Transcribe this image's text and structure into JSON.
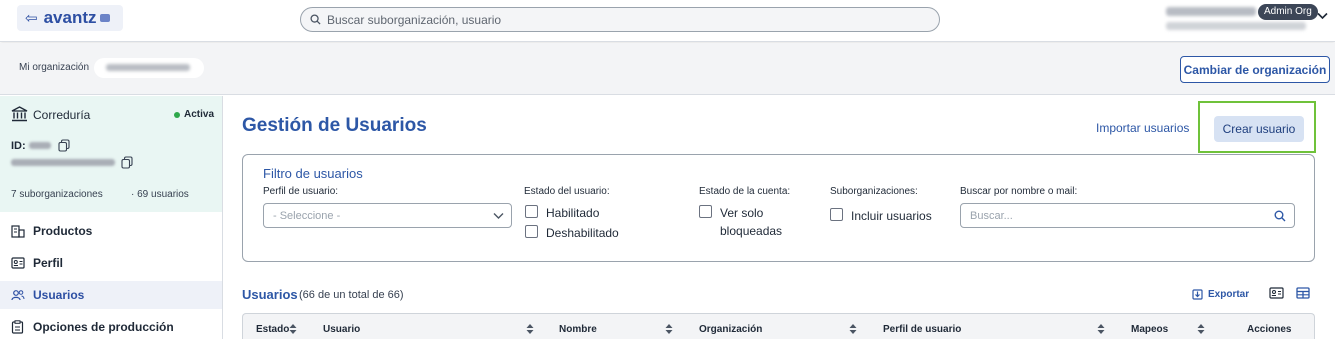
{
  "header": {
    "logo_text": "avantz",
    "search_placeholder": "Buscar suborganización, usuario",
    "role_badge": "Admin Org"
  },
  "orgbar": {
    "label": "Mi organización",
    "change_button": "Cambiar de organización"
  },
  "sidebar": {
    "org_type": "Correduría",
    "status": "Activa",
    "id_label": "ID:",
    "suborgs": "7 suborganizaciones",
    "users": "· 69 usuarios",
    "items": [
      {
        "label": "Productos",
        "icon": "buildings-icon"
      },
      {
        "label": "Perfil",
        "icon": "id-card-icon"
      },
      {
        "label": "Usuarios",
        "icon": "users-icon"
      },
      {
        "label": "Opciones de producción",
        "icon": "clipboard-icon"
      }
    ]
  },
  "main": {
    "title": "Gestión de Usuarios",
    "import_link": "Importar usuarios",
    "create_button": "Crear usuario"
  },
  "filter": {
    "title": "Filtro de usuarios",
    "profile_label": "Perfil de usuario:",
    "profile_placeholder": "- Seleccione -",
    "user_state_label": "Estado del usuario:",
    "enabled": "Habilitado",
    "disabled": "Deshabilitado",
    "account_state_label": "Estado de la cuenta:",
    "blocked_line1": "Ver solo",
    "blocked_line2": "bloqueadas",
    "suborgs_label": "Suborganizaciones:",
    "include_users": "Incluir usuarios",
    "search_label": "Buscar por nombre o mail:",
    "search_placeholder": "Buscar..."
  },
  "users_table": {
    "title": "Usuarios",
    "count": "(66 de un total de 66)",
    "export": "Exportar",
    "columns": [
      "Estado",
      "Usuario",
      "Nombre",
      "Organización",
      "Perfil de usuario",
      "Mapeos",
      "Acciones"
    ]
  },
  "colors": {
    "primary": "#2d57a6",
    "active_green": "#2ea84b",
    "highlight": "#6fc23a",
    "org_card_bg": "#e9f6f3"
  }
}
